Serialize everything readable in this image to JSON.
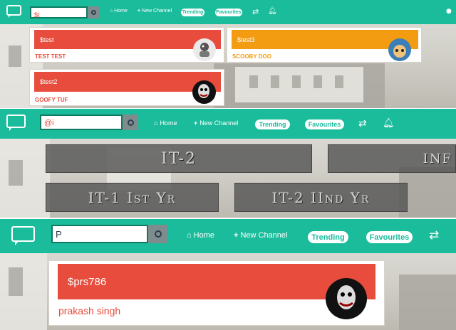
{
  "colors": {
    "nav": "#1abc9c",
    "card_red": "#e74c3c",
    "card_orange": "#f39c12",
    "name_red": "#e74c3c",
    "name_orange": "#f39c12"
  },
  "strip1": {
    "search_value": "$t",
    "nav": {
      "home": "Home",
      "new_channel": "New Channel",
      "trending": "Trending",
      "favourites": "Favourites"
    },
    "icons": [
      "chat-logo-icon",
      "search-icon",
      "home-icon",
      "plus-icon",
      "swap-icon",
      "bell-icon",
      "user-icon"
    ],
    "cards": [
      {
        "handle": "$test",
        "name": "TEST TEST"
      },
      {
        "handle": "$test3",
        "name": "SCOOBY DOO"
      },
      {
        "handle": "$test2",
        "name": "GOOFY TUF"
      }
    ]
  },
  "strip2": {
    "search_value": "@i",
    "nav": {
      "home": "Home",
      "new_channel": "New Channel",
      "trending": "Trending",
      "favourites": "Favourites"
    },
    "tiles": [
      "IT-2",
      "INF",
      "IT-1 Ist Yr",
      "IT-2 IInd Yr"
    ]
  },
  "strip3": {
    "search_value": "P",
    "nav": {
      "home": "Home",
      "new_channel": "New Channel",
      "trending": "Trending",
      "favourites": "Favourites"
    },
    "card": {
      "handle": "$prs786",
      "name": "prakash singh"
    }
  }
}
